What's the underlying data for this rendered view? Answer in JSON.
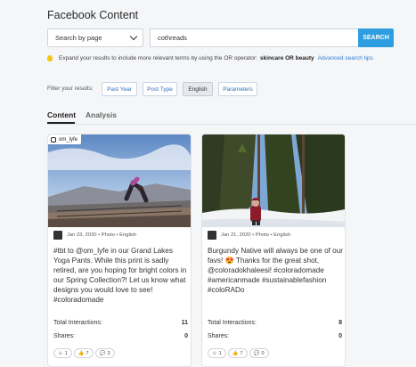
{
  "page": {
    "title": "Facebook Content"
  },
  "search": {
    "mode_value": "Search by page",
    "query": "cothreads",
    "button_label": "SEARCH"
  },
  "tip": {
    "text": "Expand your results to include more relevant terms by using the OR operator:",
    "example": "skincare OR beauty",
    "link": "Advanced search tips"
  },
  "filters": {
    "label": "Filter your results:",
    "chips": [
      {
        "label": "Past Year",
        "active": false
      },
      {
        "label": "Post Type",
        "active": false
      },
      {
        "label": "English",
        "active": true
      },
      {
        "label": "Parameters",
        "active": false
      }
    ]
  },
  "tabs": [
    {
      "label": "Content",
      "active": true
    },
    {
      "label": "Analysis",
      "active": false
    }
  ],
  "posts": [
    {
      "handle": "om_lyfe",
      "meta": "Jan 23, 2020 • Photo • English",
      "text": "#tbt to @om_lyfe in our Grand Lakes Yoga Pants. While this print is sadly retired, are you hoping for bright colors in our Spring Collection?! Let us know what designs you would love to see! #coloradomade",
      "total_label": "Total Interactions:",
      "total_value": "11",
      "shares_label": "Shares:",
      "shares_value": "0",
      "reactions": [
        "1",
        "7",
        "3"
      ]
    },
    {
      "handle": "",
      "meta": "Jan 21, 2020 • Photo • English",
      "text": "Burgundy Native will always be one of our favs! 😍 Thanks for the great shot, @coloradokhaleesi! #coloradomade #americanmade #sustainablefashion #coloRADo",
      "total_label": "Total Interactions:",
      "total_value": "8",
      "shares_label": "Shares:",
      "shares_value": "0",
      "reactions": [
        "1",
        "7",
        "0"
      ]
    }
  ],
  "colors": {
    "accent": "#2f9ee0",
    "link": "#2f7fd6"
  }
}
